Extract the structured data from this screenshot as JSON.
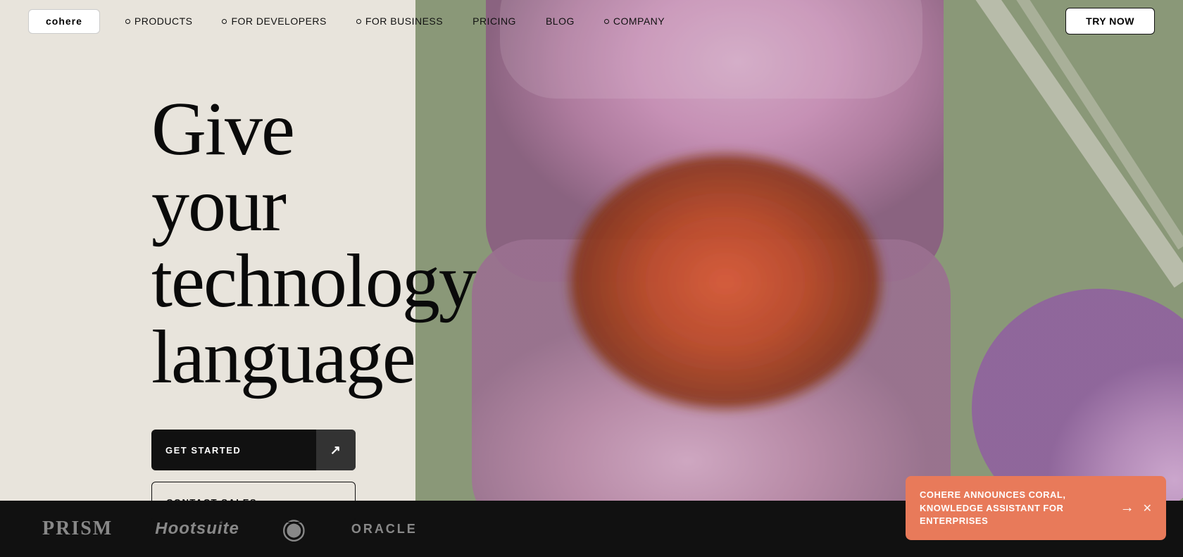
{
  "nav": {
    "logo": "cohere",
    "items": [
      {
        "label": "PRODUCTS",
        "hasDot": true
      },
      {
        "label": "FOR DEVELOPERS",
        "hasDot": true
      },
      {
        "label": "FOR BUSINESS",
        "hasDot": true
      },
      {
        "label": "PRICING",
        "hasDot": false
      },
      {
        "label": "BLOG",
        "hasDot": false
      },
      {
        "label": "COMPANY",
        "hasDot": true
      }
    ],
    "try_btn": "TRY NOW"
  },
  "hero": {
    "title_line1": "Give your",
    "title_line2": "technology",
    "title_line3": "language",
    "cta_primary": "GET STARTED",
    "cta_secondary": "CONTACT SALES",
    "arrow": "↗"
  },
  "bottom_bar": {
    "logos": [
      "PRISM",
      "HOOTSUITE",
      "Oracle",
      "ORACLE"
    ]
  },
  "toast": {
    "text": "COHERE ANNOUNCES CORAL, KNOWLEDGE ASSISTANT FOR ENTERPRISES",
    "arrow": "→",
    "close": "✕"
  }
}
